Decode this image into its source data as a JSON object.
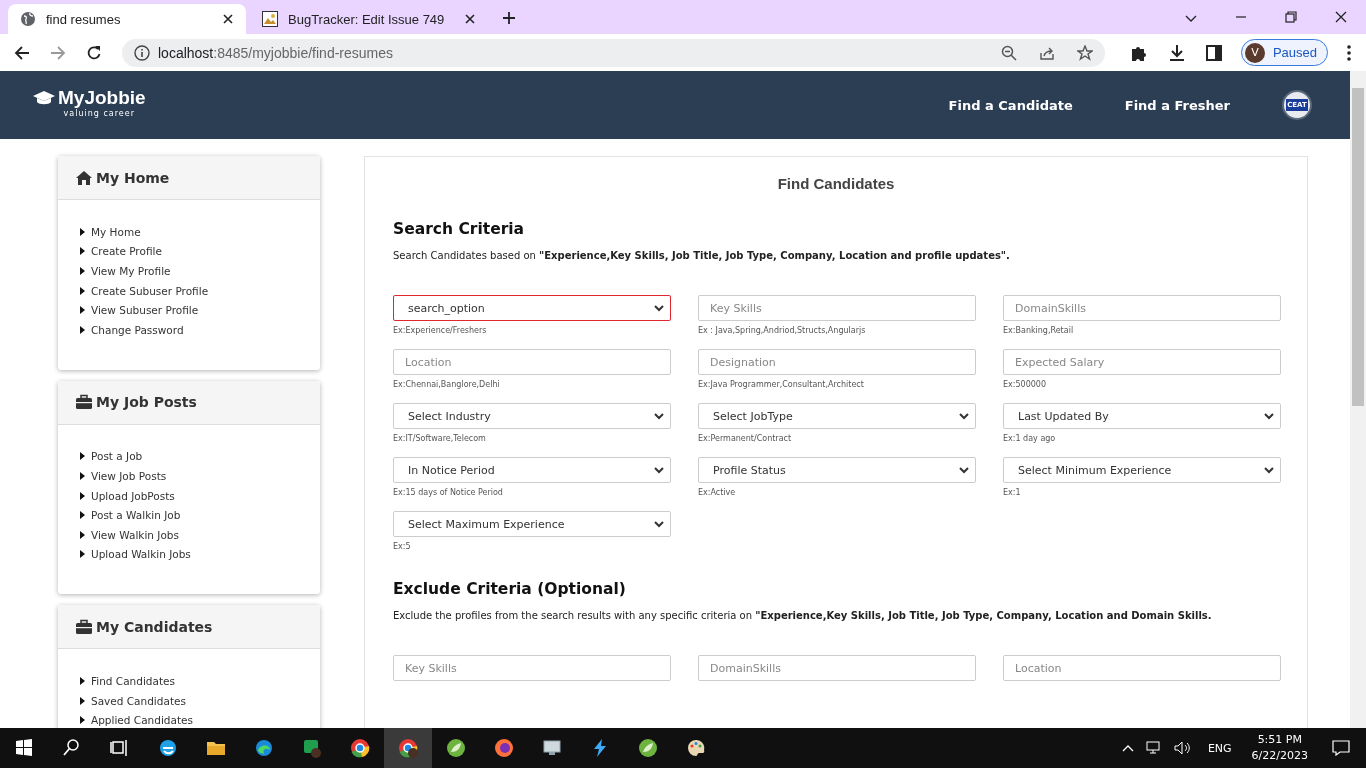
{
  "browser": {
    "tabs": [
      {
        "title": "find resumes",
        "selected": true
      },
      {
        "title": "BugTracker: Edit Issue 749",
        "selected": false
      }
    ],
    "url_host": "localhost",
    "url_path": ":8485/myjobbie/find-resumes",
    "profile_initial": "V",
    "profile_status": "Paused"
  },
  "header": {
    "logo": "MyJobbie",
    "tagline": "valuing career",
    "nav": [
      "Find a Candidate",
      "Find a Fresher"
    ],
    "company_badge": "CEAT"
  },
  "sidebar": [
    {
      "title": "My Home",
      "items": [
        "My Home",
        "Create Profile",
        "View My Profile",
        "Create Subuser Profile",
        "View Subuser Profile",
        "Change Password"
      ]
    },
    {
      "title": "My Job Posts",
      "items": [
        "Post a Job",
        "View Job Posts",
        "Upload JobPosts",
        "Post a Walkin Job",
        "View Walkin Jobs",
        "Upload Walkin Jobs"
      ]
    },
    {
      "title": "My Candidates",
      "items": [
        "Find Candidates",
        "Saved Candidates",
        "Applied Candidates"
      ]
    }
  ],
  "main": {
    "title": "Find Candidates",
    "sections": [
      {
        "heading": "Search Criteria",
        "description": "Search Candidates based on **\"Experience,Key Skills, Job Title, Job Type, Company, Location and profile updates\".**",
        "fields": [
          {
            "kind": "select",
            "value": "search_option",
            "invalid": true,
            "hint": "Ex:Experience/Freshers"
          },
          {
            "kind": "input",
            "placeholder": "Key Skills",
            "hint": "Ex : Java,Spring,Andriod,Structs,Angularjs"
          },
          {
            "kind": "input",
            "placeholder": "DomainSkills",
            "hint": "Ex:Banking,Retail"
          },
          {
            "kind": "input",
            "placeholder": "Location",
            "hint": "Ex:Chennai,Banglore,Delhi"
          },
          {
            "kind": "input",
            "placeholder": "Designation",
            "hint": "Ex:Java Programmer,Consultant,Architect"
          },
          {
            "kind": "input",
            "placeholder": "Expected Salary",
            "hint": "Ex:500000"
          },
          {
            "kind": "select",
            "value": "Select Industry",
            "invalid": false,
            "hint": "Ex:IT/Software,Telecom"
          },
          {
            "kind": "select",
            "value": "Select JobType",
            "invalid": false,
            "hint": "Ex:Permanent/Contract"
          },
          {
            "kind": "select",
            "value": "Last Updated By",
            "invalid": false,
            "hint": "Ex:1 day ago"
          },
          {
            "kind": "select",
            "value": "In Notice Period",
            "invalid": false,
            "hint": "Ex:15 days of Notice Period"
          },
          {
            "kind": "select",
            "value": "Profile Status",
            "invalid": false,
            "hint": "Ex:Active"
          },
          {
            "kind": "select",
            "value": "Select Minimum Experience",
            "invalid": false,
            "hint": "Ex:1"
          },
          {
            "kind": "select",
            "value": "Select Maximum Experience",
            "invalid": false,
            "hint": "Ex:5"
          }
        ]
      },
      {
        "heading": "Exclude Criteria (Optional)",
        "description": "Exclude the profiles from the search results with any specific criteria on **\"Experience,Key Skills, Job Title, Job Type, Company, Location and Domain Skills.**",
        "fields": [
          {
            "kind": "input",
            "placeholder": "Key Skills"
          },
          {
            "kind": "input",
            "placeholder": "DomainSkills"
          },
          {
            "kind": "input",
            "placeholder": "Location"
          }
        ]
      }
    ]
  },
  "taskbar": {
    "language": "ENG",
    "time": "5:51 PM",
    "date": "6/22/2023"
  }
}
